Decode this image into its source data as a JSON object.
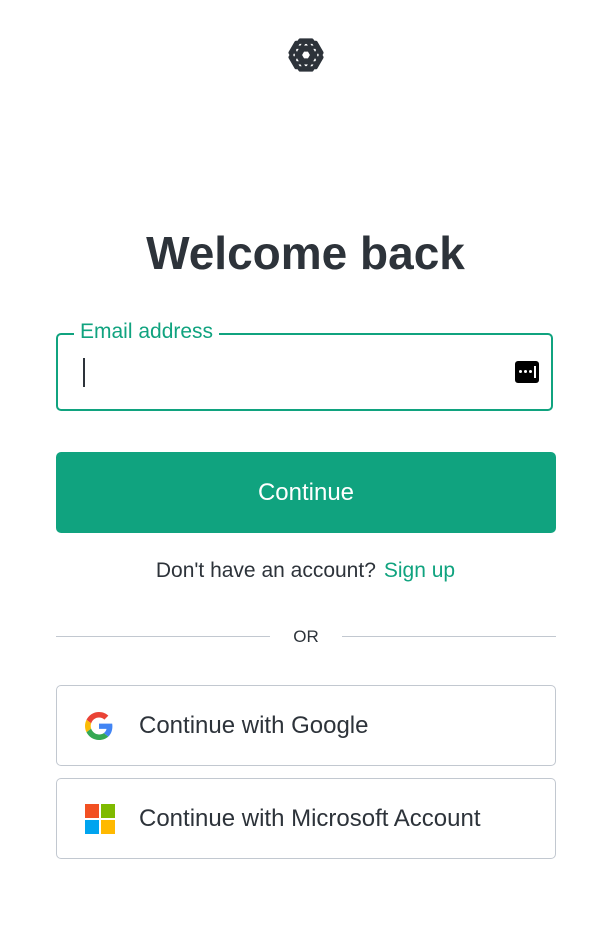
{
  "brand": {
    "logo_icon": "openai-logo-icon",
    "accent_color": "#10a37f",
    "text_color": "#2d333a",
    "border_color": "#c2c8d0"
  },
  "heading": {
    "title": "Welcome back"
  },
  "email_field": {
    "label": "Email address",
    "value": "",
    "password_manager_icon": "password-manager-icon"
  },
  "continue_button": {
    "label": "Continue"
  },
  "signup": {
    "prompt": "Don't have an account?",
    "link_label": "Sign up"
  },
  "divider": {
    "label": "OR"
  },
  "social": [
    {
      "label": "Continue with Google",
      "icon": "google-icon"
    },
    {
      "label": "Continue with Microsoft Account",
      "icon": "microsoft-icon"
    }
  ]
}
